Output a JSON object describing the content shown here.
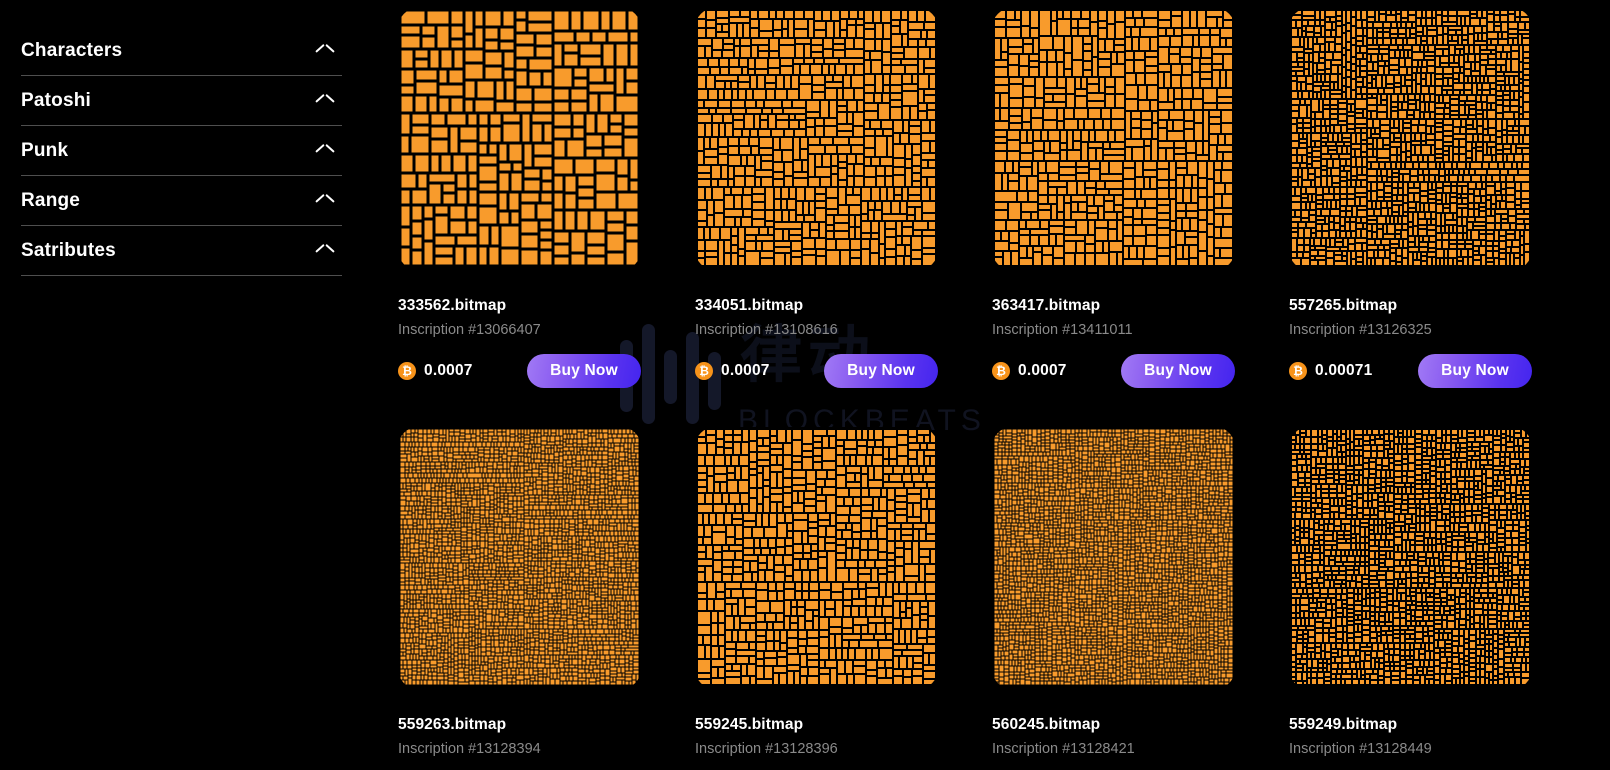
{
  "theme": {
    "background": "#000000",
    "accent_orange": "#f89b2c",
    "btc_orange": "#f7931a",
    "button_gradient_from": "#a17af5",
    "button_gradient_to": "#4425ef",
    "muted_text": "#8a8a8a",
    "divider": "#4f4f4f"
  },
  "sidebar": {
    "items": [
      {
        "label": "Characters",
        "icon": "chevron-up-icon"
      },
      {
        "label": "Patoshi",
        "icon": "chevron-up-icon"
      },
      {
        "label": "Punk",
        "icon": "chevron-up-icon"
      },
      {
        "label": "Range",
        "icon": "chevron-up-icon"
      },
      {
        "label": "Satributes",
        "icon": "chevron-up-icon"
      }
    ]
  },
  "watermark": {
    "cn_text": "律动",
    "brand": "BLOCKBEATS",
    "logo": "blockbeats-bars-icon"
  },
  "grid": {
    "buy_label": "Buy Now",
    "currency_icon": "bitcoin-icon",
    "currency_glyph": "₿",
    "cards": [
      {
        "title": "333562.bitmap",
        "inscription": "Inscription #13066407",
        "price": "0.0007",
        "buy_label": "Buy Now",
        "art": {
          "seed": 1331,
          "density": "coarse",
          "cells": 260
        }
      },
      {
        "title": "334051.bitmap",
        "inscription": "Inscription #13108616",
        "price": "0.0007",
        "buy_label": "Buy Now",
        "art": {
          "seed": 2207,
          "density": "medium",
          "cells": 620
        }
      },
      {
        "title": "363417.bitmap",
        "inscription": "Inscription #13411011",
        "price": "0.0007",
        "buy_label": "Buy Now",
        "art": {
          "seed": 4109,
          "density": "medium",
          "cells": 560
        }
      },
      {
        "title": "557265.bitmap",
        "inscription": "Inscription #13126325",
        "price": "0.00071",
        "buy_label": "Buy Now",
        "art": {
          "seed": 5531,
          "density": "fine",
          "cells": 1400
        }
      },
      {
        "title": "559263.bitmap",
        "inscription": "Inscription #13128394",
        "price": "",
        "buy_label": "",
        "art": {
          "seed": 6619,
          "density": "ultrafine",
          "cells": 3200
        }
      },
      {
        "title": "559245.bitmap",
        "inscription": "Inscription #13128396",
        "price": "",
        "buy_label": "",
        "art": {
          "seed": 7717,
          "density": "medium",
          "cells": 700
        }
      },
      {
        "title": "560245.bitmap",
        "inscription": "Inscription #13128421",
        "price": "",
        "buy_label": "",
        "art": {
          "seed": 8831,
          "density": "ultrafine",
          "cells": 3400
        }
      },
      {
        "title": "559249.bitmap",
        "inscription": "Inscription #13128449",
        "price": "",
        "buy_label": "",
        "art": {
          "seed": 9343,
          "density": "fine",
          "cells": 1800
        }
      }
    ]
  }
}
